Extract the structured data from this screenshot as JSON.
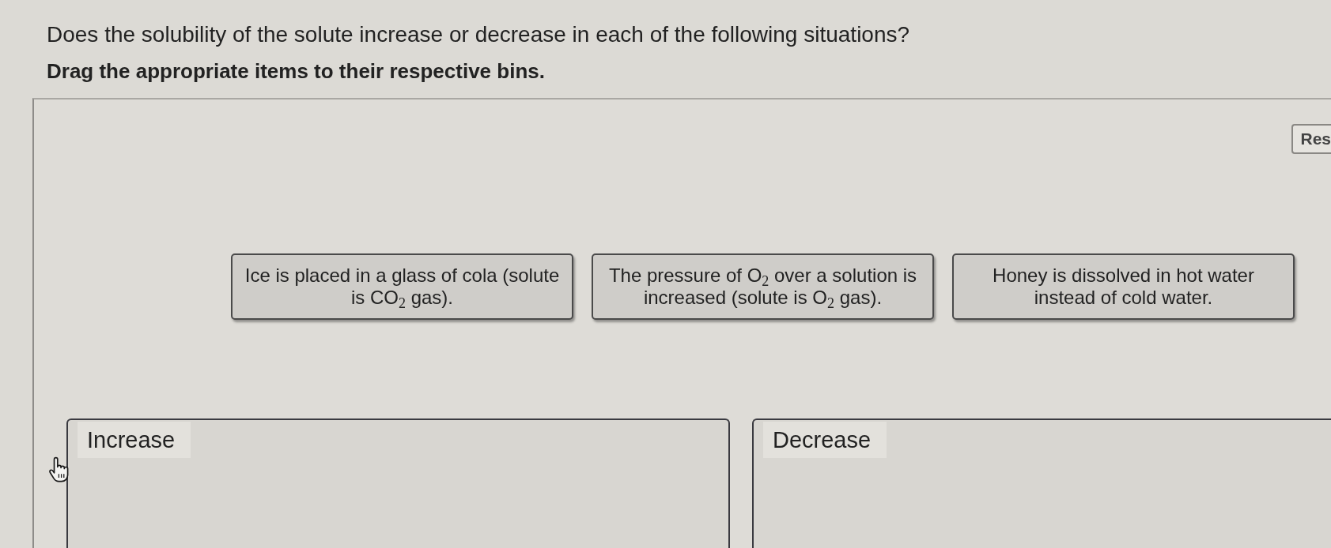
{
  "question": "Does the solubility of the solute increase or decrease in each of the following situations?",
  "instruction": "Drag the appropriate items to their respective bins.",
  "reset_button": {
    "label": "Res"
  },
  "items": [
    {
      "lines": [
        "Ice is placed in a glass of cola (solute",
        "is CO$_{2}$ gas)."
      ]
    },
    {
      "lines": [
        "The pressure of O$_{2}$ over a solution is",
        "increased (solute is O$_{2}$ gas)."
      ]
    },
    {
      "lines": [
        "Honey is dissolved in hot water",
        "instead of cold water."
      ]
    }
  ],
  "bins": [
    {
      "label": "Increase"
    },
    {
      "label": "Decrease"
    }
  ]
}
